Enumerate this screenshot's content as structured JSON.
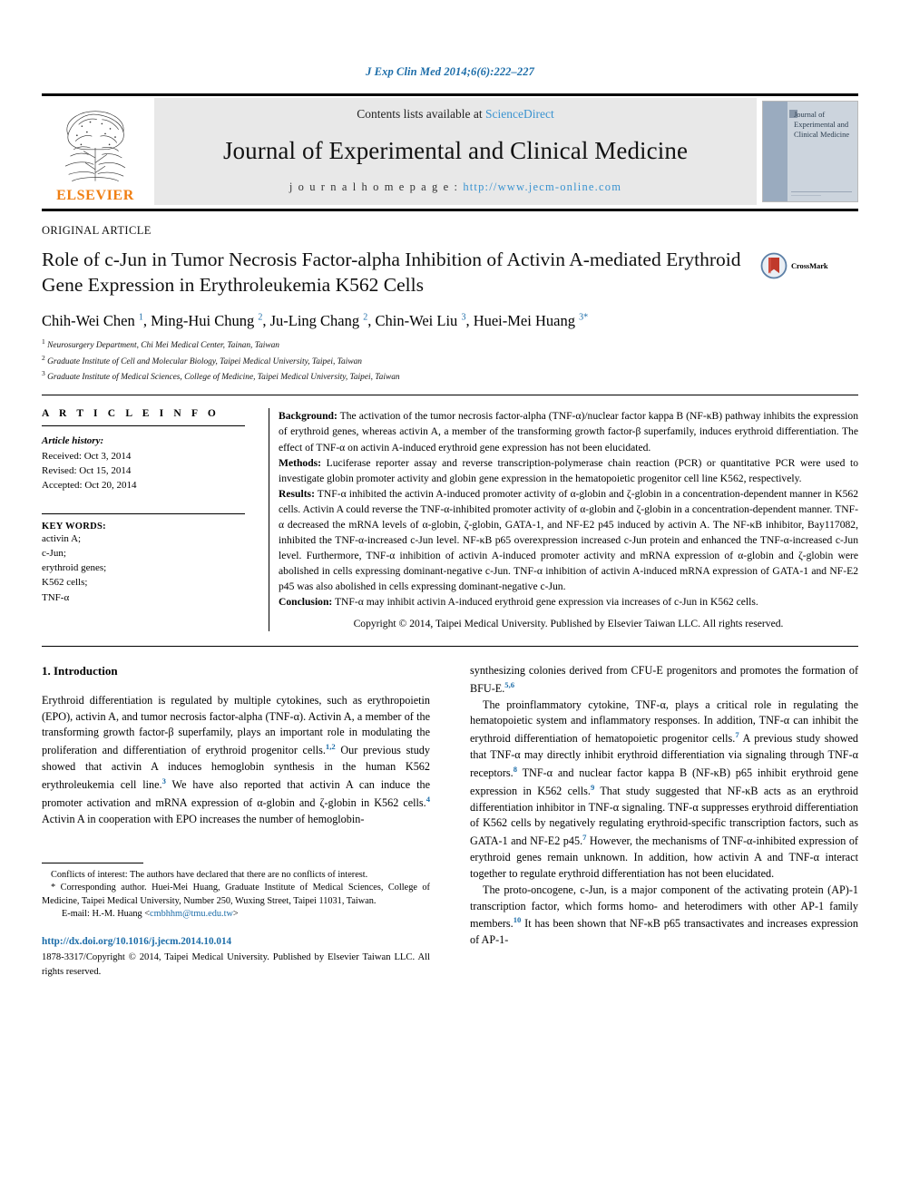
{
  "running_head": "J Exp Clin Med 2014;6(6):222–227",
  "masthead": {
    "publisher_name": "ELSEVIER",
    "contents_prefix": "Contents lists available at ",
    "contents_link": "ScienceDirect",
    "journal_name": "Journal of Experimental and Clinical Medicine",
    "homepage_prefix": "j o u r n a l   h o m e p a g e :  ",
    "homepage_url": "http://www.jecm-online.com",
    "cover_title": "Journal of Experimental and Clinical Medicine"
  },
  "article": {
    "kicker": "ORIGINAL ARTICLE",
    "title": "Role of c-Jun in Tumor Necrosis Factor-alpha Inhibition of Activin A-mediated Erythroid Gene Expression in Erythroleukemia K562 Cells",
    "crossmark_label": "CrossMark",
    "authors_html": "Chih-Wei Chen <sup>1</sup>, Ming-Hui Chung <sup>2</sup>, Ju-Ling Chang <sup>2</sup>, Chin-Wei Liu <sup>3</sup>, Huei-Mei Huang <sup>3</sup><sup class=\"star\">*</sup>",
    "affiliations": [
      "Neurosurgery Department, Chi Mei Medical Center, Tainan, Taiwan",
      "Graduate Institute of Cell and Molecular Biology, Taipei Medical University, Taipei, Taiwan",
      "Graduate Institute of Medical Sciences, College of Medicine, Taipei Medical University, Taipei, Taiwan"
    ]
  },
  "article_info": {
    "heading": "A R T I C L E   I N F O",
    "history_label": "Article history:",
    "received": "Received: Oct 3, 2014",
    "revised": "Revised: Oct 15, 2014",
    "accepted": "Accepted: Oct 20, 2014",
    "keywords_label": "KEY WORDS:",
    "keywords": [
      "activin A;",
      "c-Jun;",
      "erythroid genes;",
      "K562 cells;",
      "TNF-α"
    ]
  },
  "abstract": {
    "background_label": "Background:",
    "background": " The activation of the tumor necrosis factor-alpha (TNF-α)/nuclear factor kappa B (NF-κB) pathway inhibits the expression of erythroid genes, whereas activin A, a member of the transforming growth factor-β superfamily, induces erythroid differentiation. The effect of TNF-α on activin A-induced erythroid gene expression has not been elucidated.",
    "methods_label": "Methods:",
    "methods": " Luciferase reporter assay and reverse transcription-polymerase chain reaction (PCR) or quantitative PCR were used to investigate globin promoter activity and globin gene expression in the hematopoietic progenitor cell line K562, respectively.",
    "results_label": "Results:",
    "results": " TNF-α inhibited the activin A-induced promoter activity of α-globin and ζ-globin in a concentration-dependent manner in K562 cells. Activin A could reverse the TNF-α-inhibited promoter activity of α-globin and ζ-globin in a concentration-dependent manner. TNF-α decreased the mRNA levels of α-globin, ζ-globin, GATA-1, and NF-E2 p45 induced by activin A. The NF-κB inhibitor, Bay117082, inhibited the TNF-α-increased c-Jun level. NF-κB p65 overexpression increased c-Jun protein and enhanced the TNF-α-increased c-Jun level. Furthermore, TNF-α inhibition of activin A-induced promoter activity and mRNA expression of α-globin and ζ-globin were abolished in cells expressing dominant-negative c-Jun. TNF-α inhibition of activin A-induced mRNA expression of GATA-1 and NF-E2 p45 was also abolished in cells expressing dominant-negative c-Jun.",
    "conclusion_label": "Conclusion:",
    "conclusion": " TNF-α may inhibit activin A-induced erythroid gene expression via increases of c-Jun in K562 cells.",
    "copyright": "Copyright © 2014, Taipei Medical University. Published by Elsevier Taiwan LLC. All rights reserved."
  },
  "introduction": {
    "heading": "1.  Introduction",
    "left_p1_html": "Erythroid differentiation is regulated by multiple cytokines, such as erythropoietin (EPO), activin A, and tumor necrosis factor-alpha (TNF-α). Activin A, a member of the transforming growth factor-β superfamily, plays an important role in modulating the proliferation and differentiation of erythroid progenitor cells.<sup class=\"ref\">1,2</sup> Our previous study showed that activin A induces hemoglobin synthesis in the human K562 erythroleukemia cell line.<sup class=\"ref\">3</sup> We have also reported that activin A can induce the promoter activation and mRNA expression of α-globin and ζ-globin in K562 cells.<sup class=\"ref\">4</sup> Activin A in cooperation with EPO increases the number of hemoglobin-",
    "right_p1_html": "synthesizing colonies derived from CFU-E progenitors and promotes the formation of BFU-E.<sup class=\"ref\">5,6</sup>",
    "right_p2_html": "The proinflammatory cytokine, TNF-α, plays a critical role in regulating the hematopoietic system and inflammatory responses. In addition, TNF-α can inhibit the erythroid differentiation of hematopoietic progenitor cells.<sup class=\"ref\">7</sup> A previous study showed that TNF-α may directly inhibit erythroid differentiation via signaling through TNF-α receptors.<sup class=\"ref\">8</sup> TNF-α and nuclear factor kappa B (NF-κB) p65 inhibit erythroid gene expression in K562 cells.<sup class=\"ref\">9</sup> That study suggested that NF-κB acts as an erythroid differentiation inhibitor in TNF-α signaling. TNF-α suppresses erythroid differentiation of K562 cells by negatively regulating erythroid-specific transcription factors, such as GATA-1 and NF-E2 p45.<sup class=\"ref\">7</sup> However, the mechanisms of TNF-α-inhibited expression of erythroid genes remain unknown. In addition, how activin A and TNF-α interact together to regulate erythroid differentiation has not been elucidated.",
    "right_p3_html": "The proto-oncogene, c-Jun, is a major component of the activating protein (AP)-1 transcription factor, which forms homo- and heterodimers with other AP-1 family members.<sup class=\"ref\">10</sup> It has been shown that NF-κB p65 transactivates and increases expression of AP-1-"
  },
  "footnotes": {
    "conflicts": "Conflicts of interest: The authors have declared that there are no conflicts of interest.",
    "corresponding": "* Corresponding author. Huei-Mei Huang, Graduate Institute of Medical Sciences, College of Medicine, Taipei Medical University, Number 250, Wuxing Street, Taipei 11031, Taiwan.",
    "email_prefix": "E-mail: H.-M. Huang <",
    "email_address": "cmbhhm@tmu.edu.tw",
    "email_suffix": ">"
  },
  "footer": {
    "doi": "http://dx.doi.org/10.1016/j.jecm.2014.10.014",
    "issn_line": "1878-3317/Copyright © 2014, Taipei Medical University. Published by Elsevier Taiwan LLC. All rights reserved."
  },
  "colors": {
    "link": "#1b6ca8",
    "elsevier_orange": "#f07f13",
    "masthead_gray": "#e8e8e8",
    "crossmark_red": "#c0392b"
  }
}
